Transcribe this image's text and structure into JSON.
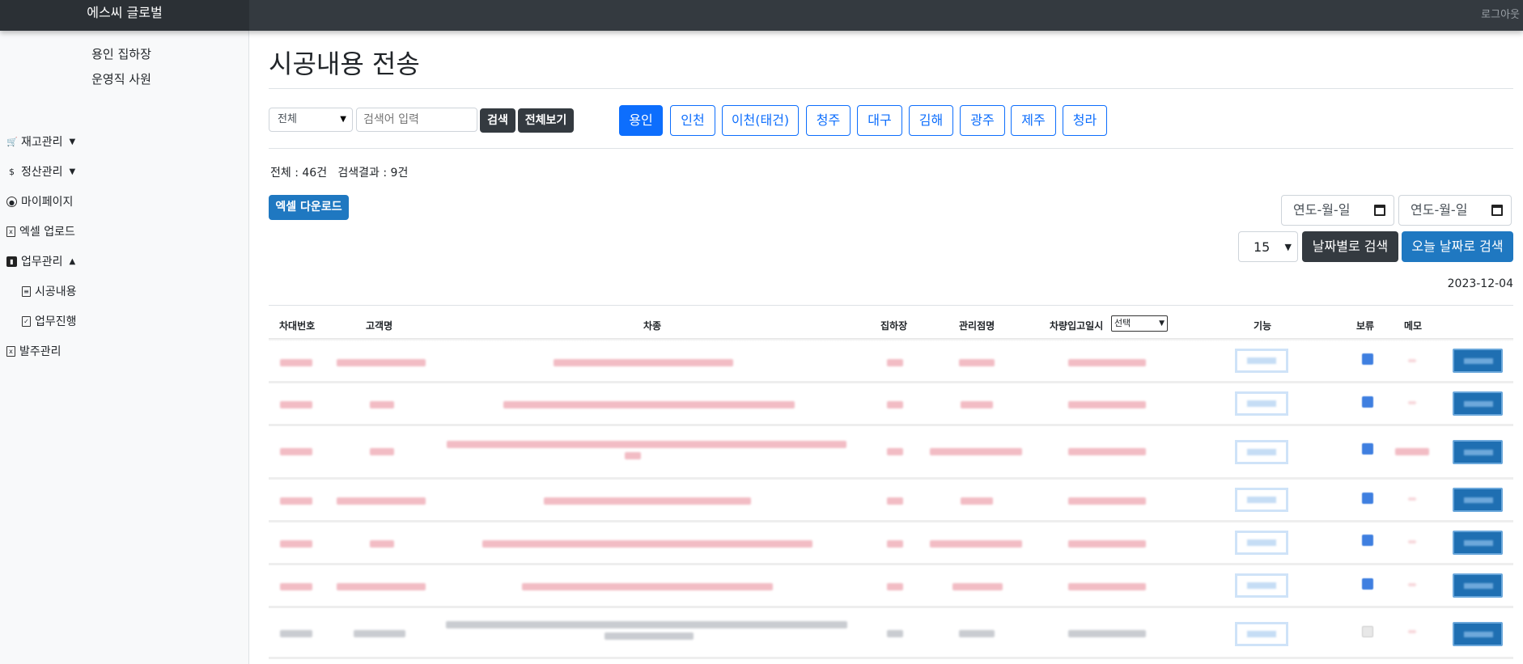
{
  "app": {
    "brand": "에스씨 글로벌",
    "logout": "로그아웃"
  },
  "sidebar": {
    "sub_items": [
      "용인 집하장",
      "운영직 사원"
    ],
    "items": [
      {
        "label": "재고관리",
        "icon": "cart-icon",
        "caret": "▼"
      },
      {
        "label": "정산관리",
        "icon": "dollar-icon",
        "caret": "▼"
      },
      {
        "label": "마이페이지",
        "icon": "user-circle-icon",
        "caret": ""
      },
      {
        "label": "엑셀 업로드",
        "icon": "excel-file-icon",
        "caret": ""
      },
      {
        "label": "업무관리",
        "icon": "chart-icon",
        "caret": "▲"
      },
      {
        "label": "발주관리",
        "icon": "excel-file-icon",
        "caret": ""
      }
    ],
    "children": [
      {
        "label": "시공내용",
        "icon": "file-icon"
      },
      {
        "label": "업무진행",
        "icon": "clipboard-icon"
      }
    ]
  },
  "main": {
    "title": "시공내용 전송",
    "filter": {
      "select_value": "전체",
      "search_placeholder": "검색어 입력",
      "search_label": "검색",
      "view_all_label": "전체보기"
    },
    "regions": [
      "용인",
      "인천",
      "이천(태건)",
      "청주",
      "대구",
      "김해",
      "광주",
      "제주",
      "청라"
    ],
    "active_region": "용인",
    "counts": "전체 : 46건   검색결과 : 9건",
    "excel_download_label": "엑셀 다운로드",
    "date_from_placeholder": "연도-월-일",
    "date_to_placeholder": "연도-월-일",
    "per_page": "15",
    "date_search_label": "날짜별로 검색",
    "today_search_label": "오늘 날짜로 검색",
    "today_date": "2023-12-04"
  },
  "table": {
    "headers": [
      "차대번호",
      "고객명",
      "차종",
      "집하장",
      "관리점명",
      "차량입고일시",
      "기능",
      "보류",
      "메모"
    ],
    "entry_date_filter": "선택",
    "rows_note_hidden": true
  },
  "colors": {
    "primary": "#0d6efd",
    "dark": "#343a40",
    "accent_blue": "#1f78c1"
  }
}
